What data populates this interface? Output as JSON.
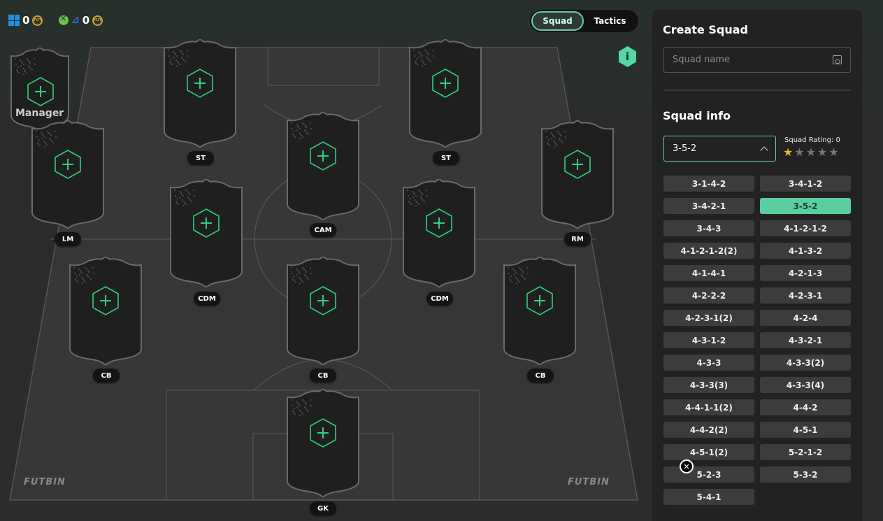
{
  "topbar": {
    "pc_coins": "0",
    "console_coins": "0",
    "coin_symbol": "FUT"
  },
  "view_toggle": {
    "squad_label": "Squad",
    "tactics_label": "Tactics",
    "active": "Squad"
  },
  "info_badge": "i",
  "manager": {
    "label": "Manager"
  },
  "positions": {
    "st_left": "ST",
    "st_right": "ST",
    "cam": "CAM",
    "lm": "LM",
    "rm": "RM",
    "cdm_left": "CDM",
    "cdm_right": "CDM",
    "cb_left": "CB",
    "cb_center": "CB",
    "cb_right": "CB",
    "gk": "GK"
  },
  "watermark": "FUTBIN",
  "panel": {
    "create_title": "Create Squad",
    "squad_name_placeholder": "Squad name",
    "info_title": "Squad info",
    "selected_formation": "3-5-2",
    "rating_label": "Squad Rating: 0",
    "rating_stars": 0.5,
    "formations": [
      "3-1-4-2",
      "3-4-1-2",
      "3-4-2-1",
      "3-5-2",
      "3-4-3",
      "4-1-2-1-2",
      "4-1-2-1-2(2)",
      "4-1-3-2",
      "4-1-4-1",
      "4-2-1-3",
      "4-2-2-2",
      "4-2-3-1",
      "4-2-3-1(2)",
      "4-2-4",
      "4-3-1-2",
      "4-3-2-1",
      "4-3-3",
      "4-3-3(2)",
      "4-3-3(3)",
      "4-3-3(4)",
      "4-4-1-1(2)",
      "4-4-2",
      "4-4-2(2)",
      "4-5-1",
      "4-5-1(2)",
      "5-2-1-2",
      "5-2-3",
      "5-3-2",
      "5-4-1"
    ]
  },
  "colors": {
    "accent": "#59cfa1",
    "plus_green": "#2fd07a",
    "panel_bg": "#222222"
  }
}
